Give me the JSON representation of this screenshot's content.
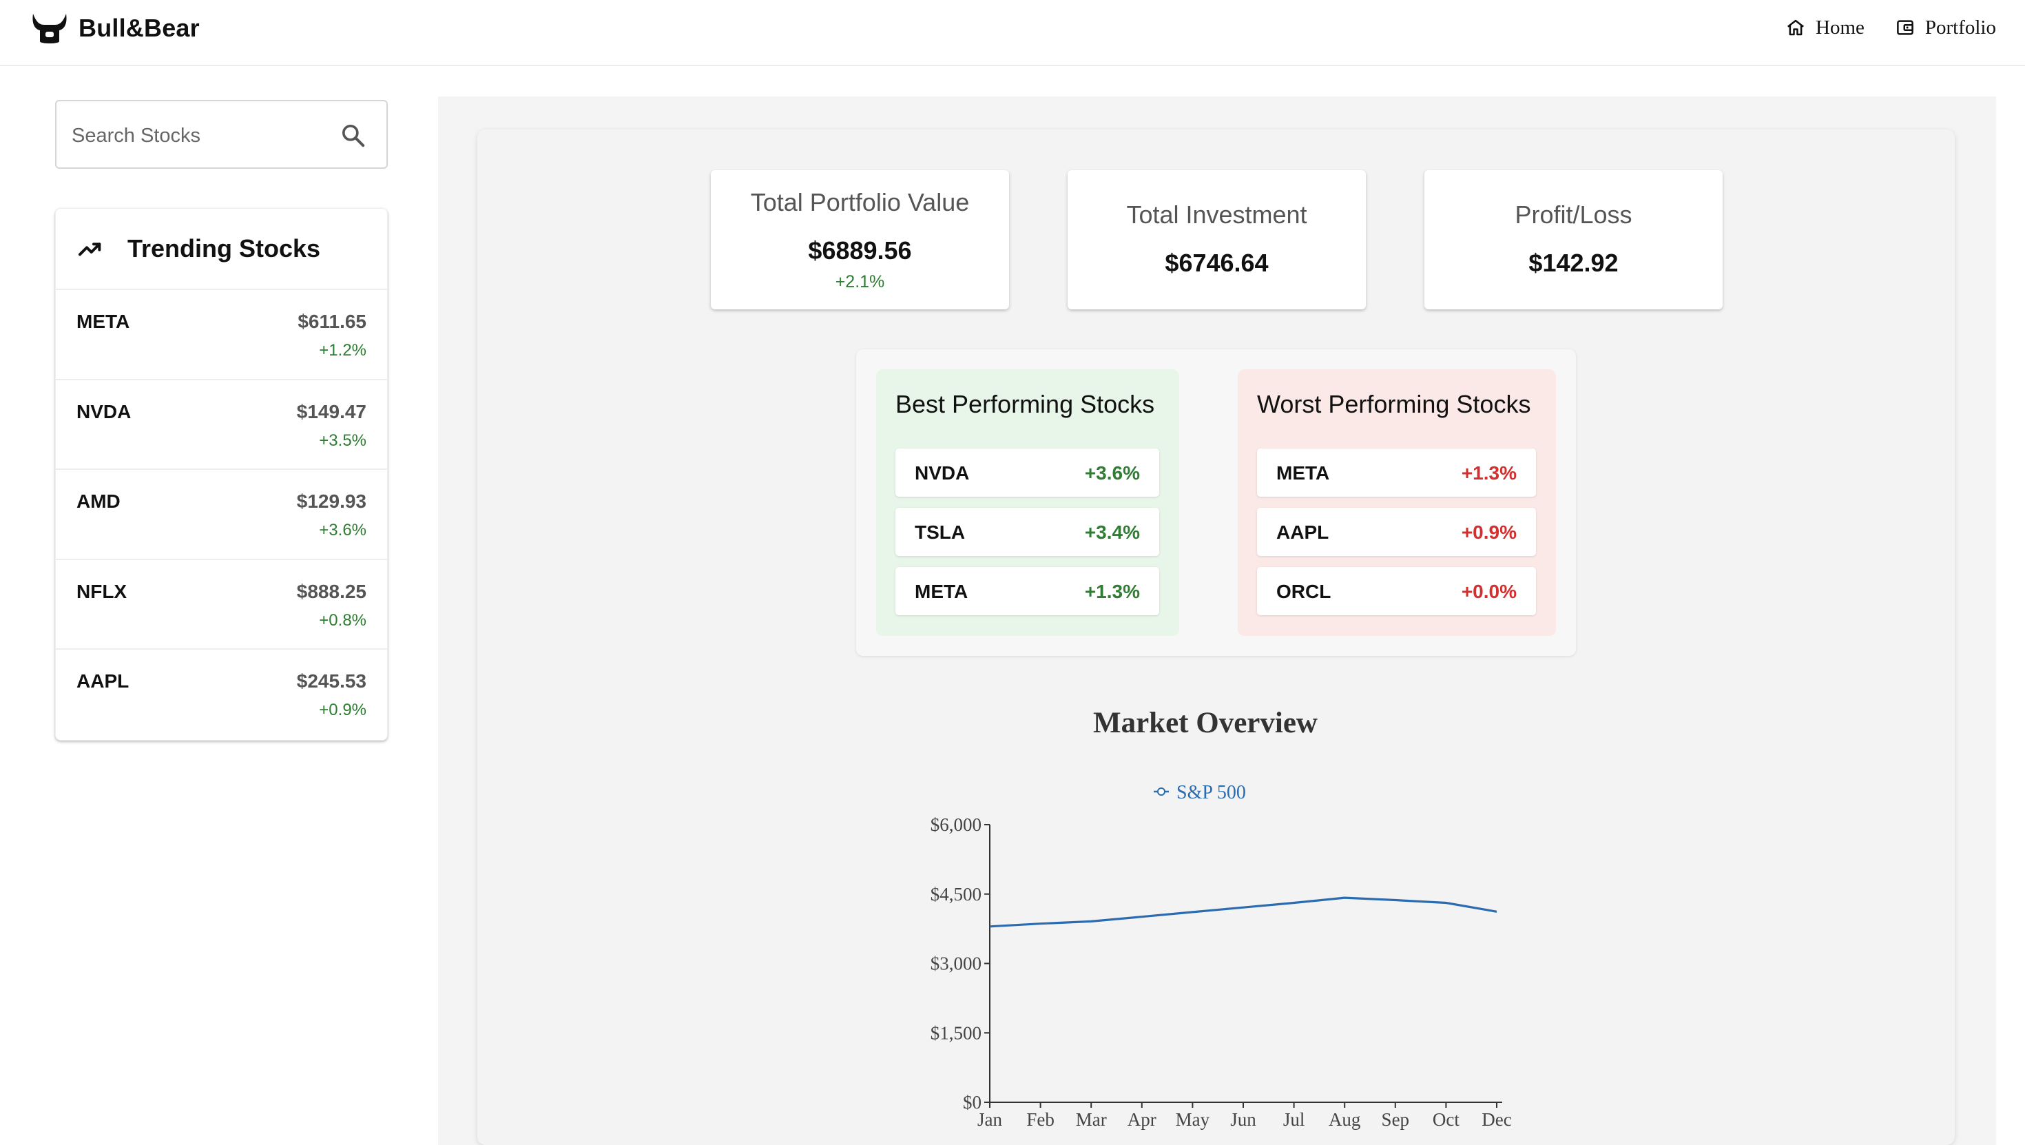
{
  "app": {
    "brand": "Bull&Bear"
  },
  "nav": {
    "items": [
      {
        "label": "Home",
        "icon": "home-icon"
      },
      {
        "label": "Portfolio",
        "icon": "wallet-icon"
      }
    ]
  },
  "search": {
    "placeholder": "Search Stocks",
    "value": ""
  },
  "trending": {
    "title": "Trending Stocks",
    "items": [
      {
        "symbol": "META",
        "price": "$611.65",
        "change": "+1.2%"
      },
      {
        "symbol": "NVDA",
        "price": "$149.47",
        "change": "+3.5%"
      },
      {
        "symbol": "AMD",
        "price": "$129.93",
        "change": "+3.6%"
      },
      {
        "symbol": "NFLX",
        "price": "$888.25",
        "change": "+0.8%"
      },
      {
        "symbol": "AAPL",
        "price": "$245.53",
        "change": "+0.9%"
      }
    ]
  },
  "summary": {
    "total_value": {
      "label": "Total Portfolio Value",
      "value": "$6889.56",
      "change": "+2.1%"
    },
    "total_investment": {
      "label": "Total Investment",
      "value": "$6746.64"
    },
    "profit_loss": {
      "label": "Profit/Loss",
      "value": "$142.92"
    }
  },
  "performance": {
    "best": {
      "title": "Best Performing Stocks",
      "items": [
        {
          "symbol": "NVDA",
          "change": "+3.6%"
        },
        {
          "symbol": "TSLA",
          "change": "+3.4%"
        },
        {
          "symbol": "META",
          "change": "+1.3%"
        }
      ]
    },
    "worst": {
      "title": "Worst Performing Stocks",
      "items": [
        {
          "symbol": "META",
          "change": "+1.3%"
        },
        {
          "symbol": "AAPL",
          "change": "+0.9%"
        },
        {
          "symbol": "ORCL",
          "change": "+0.0%"
        }
      ]
    }
  },
  "colors": {
    "positive": "#2e7d32",
    "negative": "#d32f2f",
    "line": "#2b6cb0",
    "best_bg": "#e8f5e9",
    "worst_bg": "#fbe9e7"
  },
  "chart_data": {
    "type": "line",
    "title": "Market Overview",
    "categories": [
      "Jan",
      "Feb",
      "Mar",
      "Apr",
      "May",
      "Jun",
      "Jul",
      "Aug",
      "Sep",
      "Oct",
      "Dec"
    ],
    "series": [
      {
        "name": "S&P 500",
        "values": [
          3800,
          3860,
          3910,
          4010,
          4110,
          4210,
          4310,
          4420,
          4370,
          4310,
          4120
        ]
      }
    ],
    "ylim": [
      0,
      6000
    ],
    "yticks": [
      0,
      1500,
      3000,
      4500,
      6000
    ],
    "ytick_labels": [
      "$0",
      "$1,500",
      "$3,000",
      "$4,500",
      "$6,000"
    ],
    "legend": "top-center",
    "grid": false
  }
}
